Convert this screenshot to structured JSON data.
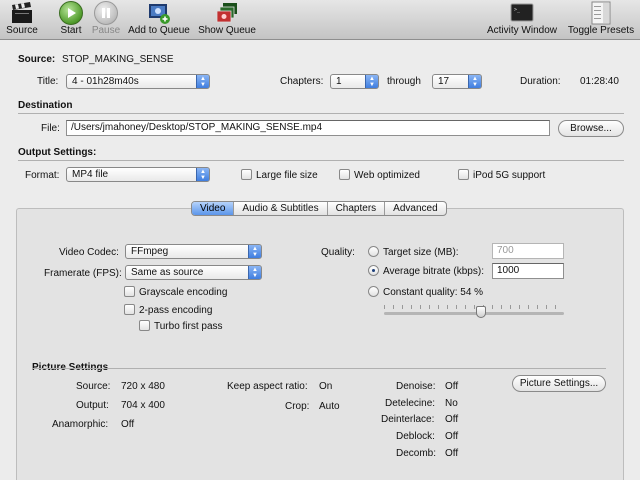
{
  "toolbar": {
    "source": "Source",
    "start": "Start",
    "pause": "Pause",
    "add_to_queue": "Add to Queue",
    "show_queue": "Show Queue",
    "activity_window": "Activity Window",
    "toggle_presets": "Toggle Presets"
  },
  "source": {
    "label": "Source:",
    "value": "STOP_MAKING_SENSE",
    "title_label": "Title:",
    "title_value": "4 - 01h28m40s",
    "chapters_label": "Chapters:",
    "chapter_start": "1",
    "through_label": "through",
    "chapter_end": "17",
    "duration_label": "Duration:",
    "duration_value": "01:28:40"
  },
  "destination": {
    "heading": "Destination",
    "file_label": "File:",
    "file_value": "/Users/jmahoney/Desktop/STOP_MAKING_SENSE.mp4",
    "browse": "Browse..."
  },
  "output": {
    "heading": "Output Settings:",
    "format_label": "Format:",
    "format_value": "MP4 file",
    "large_file": "Large file size",
    "web_optimized": "Web optimized",
    "ipod": "iPod 5G support"
  },
  "tabs": [
    "Video",
    "Audio & Subtitles",
    "Chapters",
    "Advanced"
  ],
  "video": {
    "codec_label": "Video Codec:",
    "codec_value": "FFmpeg",
    "framerate_label": "Framerate (FPS):",
    "framerate_value": "Same as source",
    "grayscale": "Grayscale encoding",
    "two_pass": "2-pass encoding",
    "turbo": "Turbo first pass",
    "quality_label": "Quality:",
    "target_size_label": "Target size (MB):",
    "target_size_value": "700",
    "avg_bitrate_label": "Average bitrate (kbps):",
    "avg_bitrate_value": "1000",
    "constant_quality_label": "Constant quality: 54 %",
    "constant_quality_level": 0.54
  },
  "picture": {
    "heading": "Picture Settings",
    "source_label": "Source:",
    "source_value": "720 x 480",
    "output_label": "Output:",
    "output_value": "704 x 400",
    "anamorphic_label": "Anamorphic:",
    "anamorphic_value": "Off",
    "keep_aspect_label": "Keep aspect ratio:",
    "keep_aspect_value": "On",
    "crop_label": "Crop:",
    "crop_value": "Auto",
    "denoise_label": "Denoise:",
    "denoise_value": "Off",
    "detelecine_label": "Detelecine:",
    "detelecine_value": "No",
    "deinterlace_label": "Deinterlace:",
    "deinterlace_value": "Off",
    "deblock_label": "Deblock:",
    "deblock_value": "Off",
    "decomb_label": "Decomb:",
    "decomb_value": "Off",
    "settings_button": "Picture Settings..."
  }
}
